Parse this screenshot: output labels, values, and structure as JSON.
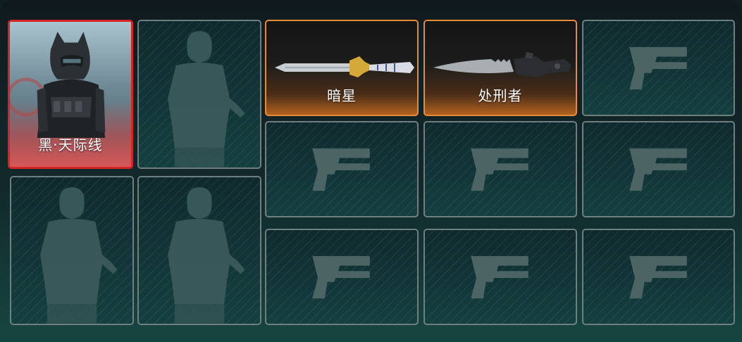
{
  "loadout": {
    "characters": [
      {
        "name": "黑·天际线",
        "state": "equipped"
      },
      {
        "name": "",
        "state": "empty"
      },
      {
        "name": "",
        "state": "empty"
      },
      {
        "name": "",
        "state": "empty"
      }
    ],
    "weapons": [
      {
        "name": "暗星",
        "state": "equipped",
        "icon": "knife-icon"
      },
      {
        "name": "处刑者",
        "state": "equipped",
        "icon": "serrated-knife-icon"
      },
      {
        "name": "",
        "state": "empty",
        "icon": "pistol-icon"
      },
      {
        "name": "",
        "state": "empty",
        "icon": "pistol-icon"
      },
      {
        "name": "",
        "state": "empty",
        "icon": "pistol-icon"
      },
      {
        "name": "",
        "state": "empty",
        "icon": "pistol-icon"
      },
      {
        "name": "",
        "state": "empty",
        "icon": "pistol-icon"
      },
      {
        "name": "",
        "state": "empty",
        "icon": "pistol-icon"
      },
      {
        "name": "",
        "state": "empty",
        "icon": "pistol-icon"
      }
    ]
  },
  "colors": {
    "character_selected_border": "#d42424",
    "weapon_selected_border": "#e98a3a",
    "empty_slot_border": "#6f7f80"
  }
}
